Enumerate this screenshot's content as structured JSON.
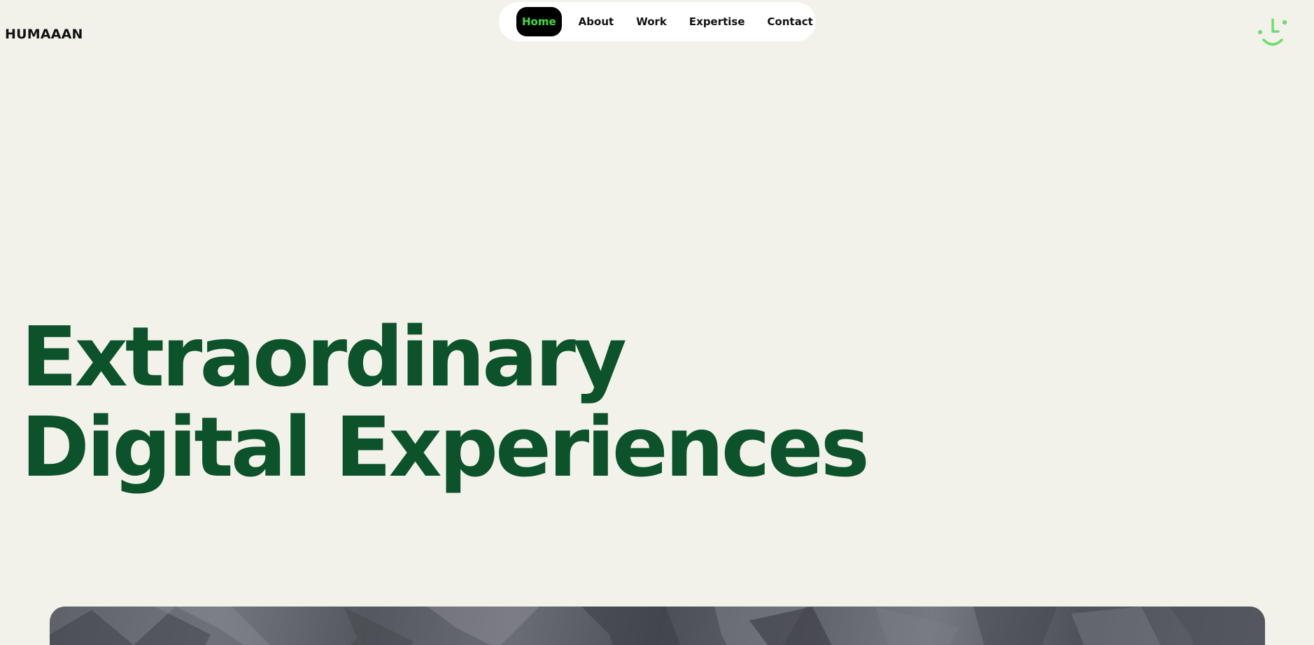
{
  "header": {
    "brand": "HUMAAAN",
    "logo_icon": "smiley-face-icon",
    "accent_color": "#6ddc6d"
  },
  "nav": {
    "items": [
      {
        "label": "Home",
        "active": true
      },
      {
        "label": "About",
        "active": false
      },
      {
        "label": "Work",
        "active": false
      },
      {
        "label": "Expertise",
        "active": false
      },
      {
        "label": "Contact",
        "active": false
      }
    ],
    "active_bg": "#000000",
    "active_text_color": "#3ee03e"
  },
  "hero": {
    "line1": "Extraordinary",
    "line2": "Digital Experiences",
    "color": "#0c532b"
  },
  "media": {
    "icon": "crumpled-fabric-image"
  },
  "theme": {
    "background": "#f3f2ea"
  }
}
